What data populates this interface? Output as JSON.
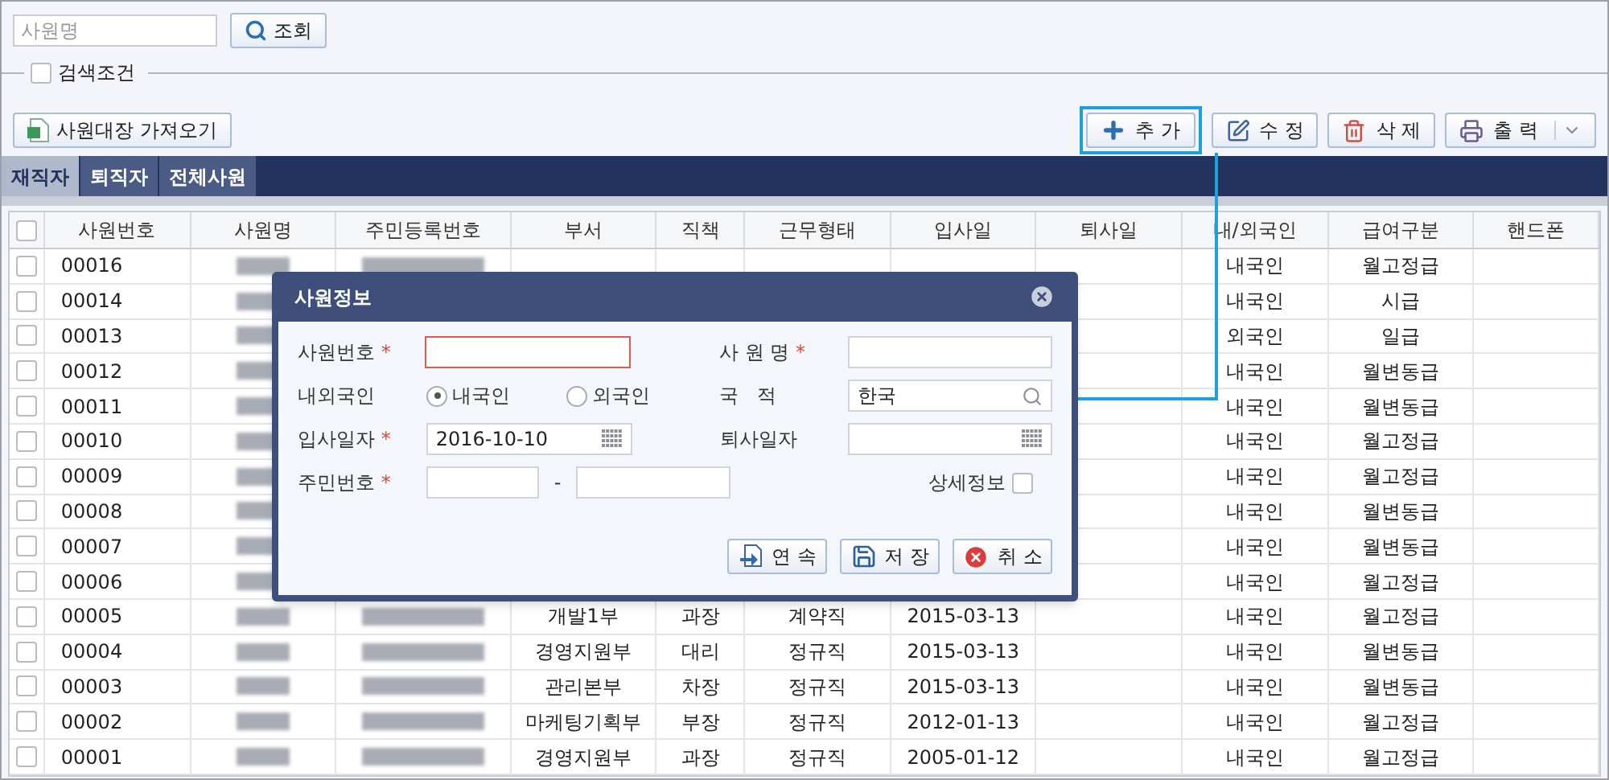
{
  "search": {
    "placeholder": "사원명",
    "button": "조회"
  },
  "filter": {
    "label": "검색조건",
    "checked": false
  },
  "import_button": "사원대장 가져오기",
  "toolbar": [
    {
      "label": "추 가",
      "kind": "add"
    },
    {
      "label": "수 정",
      "kind": "edit"
    },
    {
      "label": "삭 제",
      "kind": "delete"
    },
    {
      "label": "출 력",
      "kind": "print"
    }
  ],
  "tabs": [
    {
      "label": "재직자",
      "selected": true
    },
    {
      "label": "퇴직자",
      "selected": false
    },
    {
      "label": "전체사원",
      "selected": false
    }
  ],
  "table": {
    "columns": [
      "사원번호",
      "사원명",
      "주민등록번호",
      "부서",
      "직책",
      "근무형태",
      "입사일",
      "퇴사일",
      "내/외국인",
      "급여구분",
      "핸드폰"
    ],
    "select_all_checked": false,
    "rows": [
      {
        "checked": false,
        "cells": [
          "00016",
          "",
          "",
          "",
          "",
          "",
          "",
          "",
          "내국인",
          "월고정급",
          ""
        ]
      },
      {
        "checked": false,
        "cells": [
          "00014",
          "",
          "",
          "",
          "",
          "",
          "",
          "",
          "내국인",
          "시급",
          ""
        ]
      },
      {
        "checked": false,
        "cells": [
          "00013",
          "",
          "",
          "",
          "",
          "",
          "",
          "",
          "외국인",
          "일급",
          ""
        ]
      },
      {
        "checked": false,
        "cells": [
          "00012",
          "",
          "",
          "",
          "",
          "",
          "",
          "",
          "내국인",
          "월변동급",
          ""
        ]
      },
      {
        "checked": false,
        "cells": [
          "00011",
          "",
          "",
          "",
          "",
          "",
          "",
          "",
          "내국인",
          "월변동급",
          ""
        ]
      },
      {
        "checked": false,
        "cells": [
          "00010",
          "",
          "",
          "",
          "",
          "",
          "",
          "",
          "내국인",
          "월고정급",
          ""
        ]
      },
      {
        "checked": false,
        "cells": [
          "00009",
          "",
          "",
          "",
          "",
          "",
          "",
          "",
          "내국인",
          "월고정급",
          ""
        ]
      },
      {
        "checked": false,
        "cells": [
          "00008",
          "",
          "",
          "",
          "",
          "",
          "",
          "",
          "내국인",
          "월변동급",
          ""
        ]
      },
      {
        "checked": false,
        "cells": [
          "00007",
          "",
          "",
          "",
          "",
          "",
          "",
          "",
          "내국인",
          "월변동급",
          ""
        ]
      },
      {
        "checked": false,
        "cells": [
          "00006",
          "",
          "",
          "",
          "",
          "",
          "",
          "",
          "내국인",
          "월고정급",
          ""
        ]
      },
      {
        "checked": false,
        "cells": [
          "00005",
          "",
          "",
          "개발1부",
          "과장",
          "계약직",
          "2015-03-13",
          "",
          "내국인",
          "월고정급",
          ""
        ]
      },
      {
        "checked": false,
        "cells": [
          "00004",
          "",
          "",
          "경영지원부",
          "대리",
          "정규직",
          "2015-03-13",
          "",
          "내국인",
          "월변동급",
          ""
        ]
      },
      {
        "checked": false,
        "cells": [
          "00003",
          "",
          "",
          "관리본부",
          "차장",
          "정규직",
          "2015-03-13",
          "",
          "내국인",
          "월변동급",
          ""
        ]
      },
      {
        "checked": false,
        "cells": [
          "00002",
          "",
          "",
          "마케팅기획부",
          "부장",
          "정규직",
          "2012-01-13",
          "",
          "내국인",
          "월고정급",
          ""
        ]
      },
      {
        "checked": false,
        "cells": [
          "00001",
          "",
          "",
          "경영지원부",
          "과장",
          "정규직",
          "2005-01-12",
          "",
          "내국인",
          "월고정급",
          ""
        ]
      }
    ]
  },
  "dialog": {
    "title": "사원정보",
    "employee_no": {
      "label": "사원번호",
      "required": "*"
    },
    "name": {
      "label": "사 원 명",
      "required": "*"
    },
    "domestic": {
      "label": "내외국인",
      "options": [
        {
          "label": "내국인",
          "selected": true
        },
        {
          "label": "외국인",
          "selected": false
        }
      ]
    },
    "nationality": {
      "label": "국   적",
      "value": "한국"
    },
    "hire_date": {
      "label": "입사일자",
      "required": "*",
      "value": "2016-10-10"
    },
    "retire_date": {
      "label": "퇴사일자"
    },
    "rrn": {
      "label": "주민번호",
      "required": "*",
      "separator": "-"
    },
    "detail": {
      "label": "상세정보",
      "checked": false
    },
    "buttons": [
      {
        "label": "연 속",
        "kind": "continue"
      },
      {
        "label": "저 장",
        "kind": "save"
      },
      {
        "label": "취 소",
        "kind": "cancel"
      }
    ]
  }
}
